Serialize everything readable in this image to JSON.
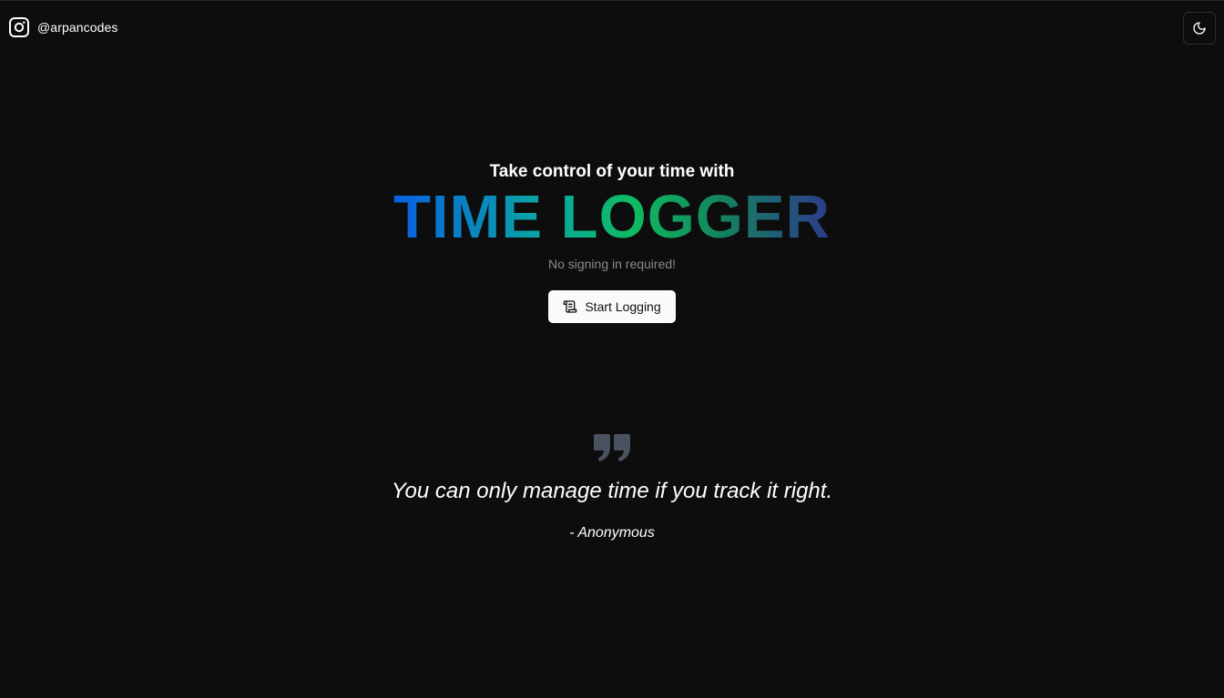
{
  "header": {
    "handle": "@arpancodes",
    "brand_icon": "instagram-icon",
    "theme_toggle_icon": "moon-icon"
  },
  "hero": {
    "tagline": "Take control of your time with",
    "title": "TIME LOGGER",
    "subtitle": "No signing in required!",
    "cta_label": "Start Logging",
    "cta_icon": "scroll-icon"
  },
  "quote": {
    "icon": "quote-icon",
    "text": "You can only manage time if you track it right.",
    "author": "- Anonymous"
  },
  "colors": {
    "background": "#0d0d0d",
    "title_gradient": [
      "#0a5fe0",
      "#0aa8a0",
      "#0fbb60",
      "#14835e",
      "#2d3a8c"
    ],
    "button_bg": "#fafafa",
    "subtitle": "#8a8a8a",
    "quote_icon": "#4a5160"
  }
}
